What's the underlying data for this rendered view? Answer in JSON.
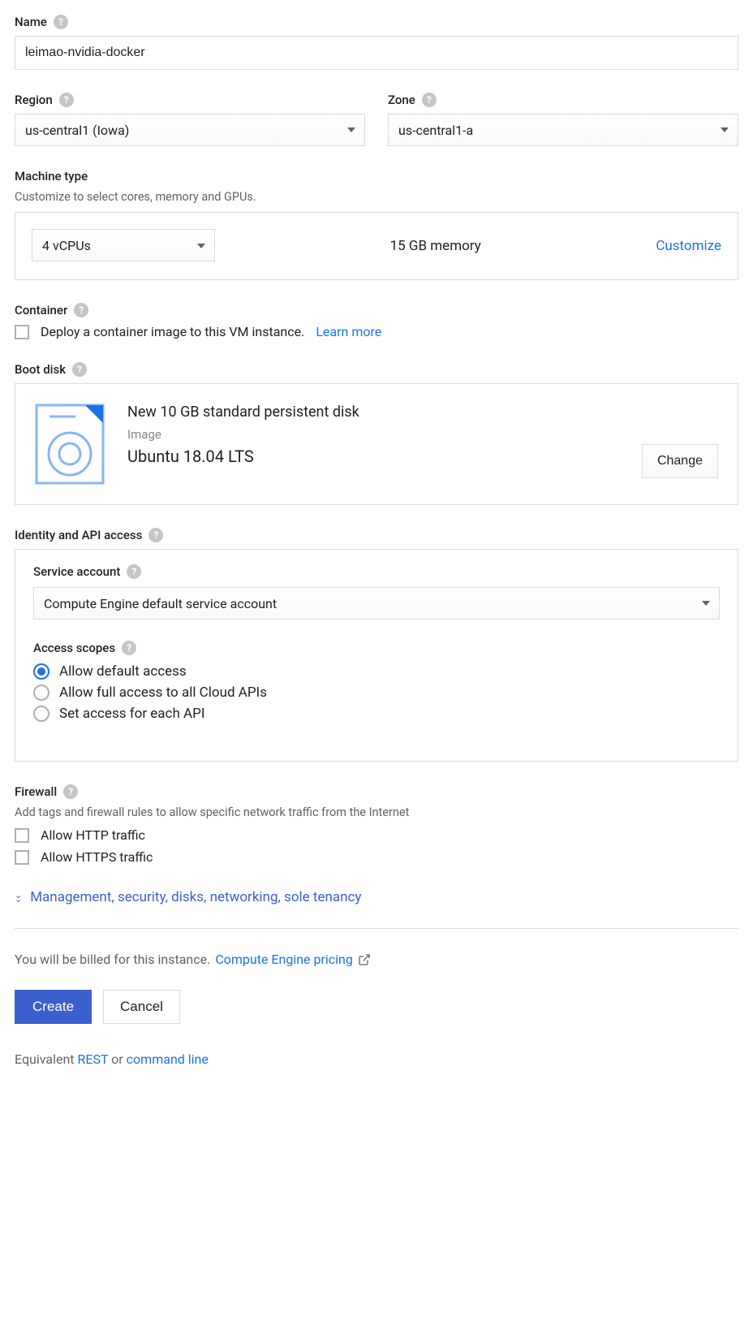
{
  "name": {
    "label": "Name",
    "value": "leimao-nvidia-docker"
  },
  "region": {
    "label": "Region",
    "value": "us-central1 (Iowa)"
  },
  "zone": {
    "label": "Zone",
    "value": "us-central1-a"
  },
  "machine": {
    "label": "Machine type",
    "description": "Customize to select cores, memory and GPUs.",
    "vcpu": "4 vCPUs",
    "memory": "15 GB memory",
    "customize": "Customize"
  },
  "container": {
    "label": "Container",
    "checkbox_label": "Deploy a container image to this VM instance.",
    "learn_more": "Learn more"
  },
  "bootdisk": {
    "label": "Boot disk",
    "title": "New 10 GB standard persistent disk",
    "image_label": "Image",
    "image_name": "Ubuntu 18.04 LTS",
    "change": "Change"
  },
  "identity": {
    "label": "Identity and API access",
    "service_account_label": "Service account",
    "service_account_value": "Compute Engine default service account",
    "access_scopes_label": "Access scopes",
    "options": [
      "Allow default access",
      "Allow full access to all Cloud APIs",
      "Set access for each API"
    ]
  },
  "firewall": {
    "label": "Firewall",
    "description": "Add tags and firewall rules to allow specific network traffic from the Internet",
    "http": "Allow HTTP traffic",
    "https": "Allow HTTPS traffic"
  },
  "expand": "Management, security, disks, networking, sole tenancy",
  "billing": {
    "note": "You will be billed for this instance.",
    "link": "Compute Engine pricing"
  },
  "actions": {
    "create": "Create",
    "cancel": "Cancel"
  },
  "equivalent": {
    "prefix": "Equivalent ",
    "rest": "REST",
    "or": " or ",
    "cli": "command line"
  }
}
